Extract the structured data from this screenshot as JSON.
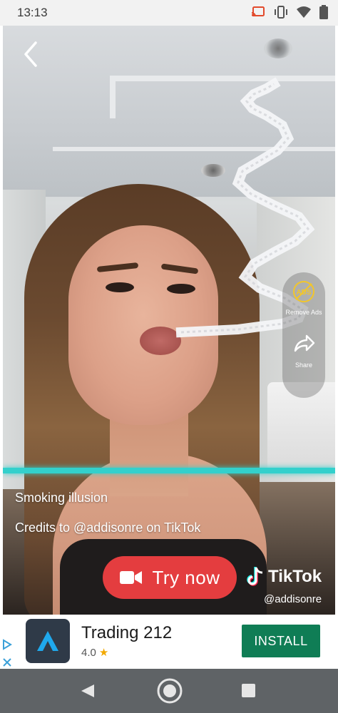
{
  "status_bar": {
    "time": "13:13",
    "icons": [
      "cast-icon",
      "vibrate-icon",
      "wifi-icon",
      "battery-icon"
    ]
  },
  "video": {
    "captions": [
      "Smoking illusion",
      "Credits to @addisonre on TikTok"
    ],
    "side_actions": {
      "remove_ads": {
        "icon": "no-ads-icon",
        "badge_text": "ADS",
        "label": "Remove Ads"
      },
      "share": {
        "icon": "share-icon",
        "label": "Share"
      }
    },
    "cta": {
      "icon": "video-camera-icon",
      "label": "Try now"
    },
    "brand": {
      "name": "TikTok",
      "handle": "@addisonre",
      "icon": "tiktok-logo-icon"
    },
    "accent_line_color": "#33d0cc",
    "cta_color": "#e43d3f"
  },
  "ad_banner": {
    "app_name": "Trading 212",
    "rating": "4.0",
    "install_label": "INSTALL",
    "install_color": "#0f7d55",
    "icons": [
      "ad-choices-icon",
      "close-icon",
      "trading212-logo-icon",
      "star-icon"
    ]
  },
  "nav_bar": {
    "icons": [
      "nav-back-icon",
      "nav-home-icon",
      "nav-recents-icon"
    ]
  }
}
